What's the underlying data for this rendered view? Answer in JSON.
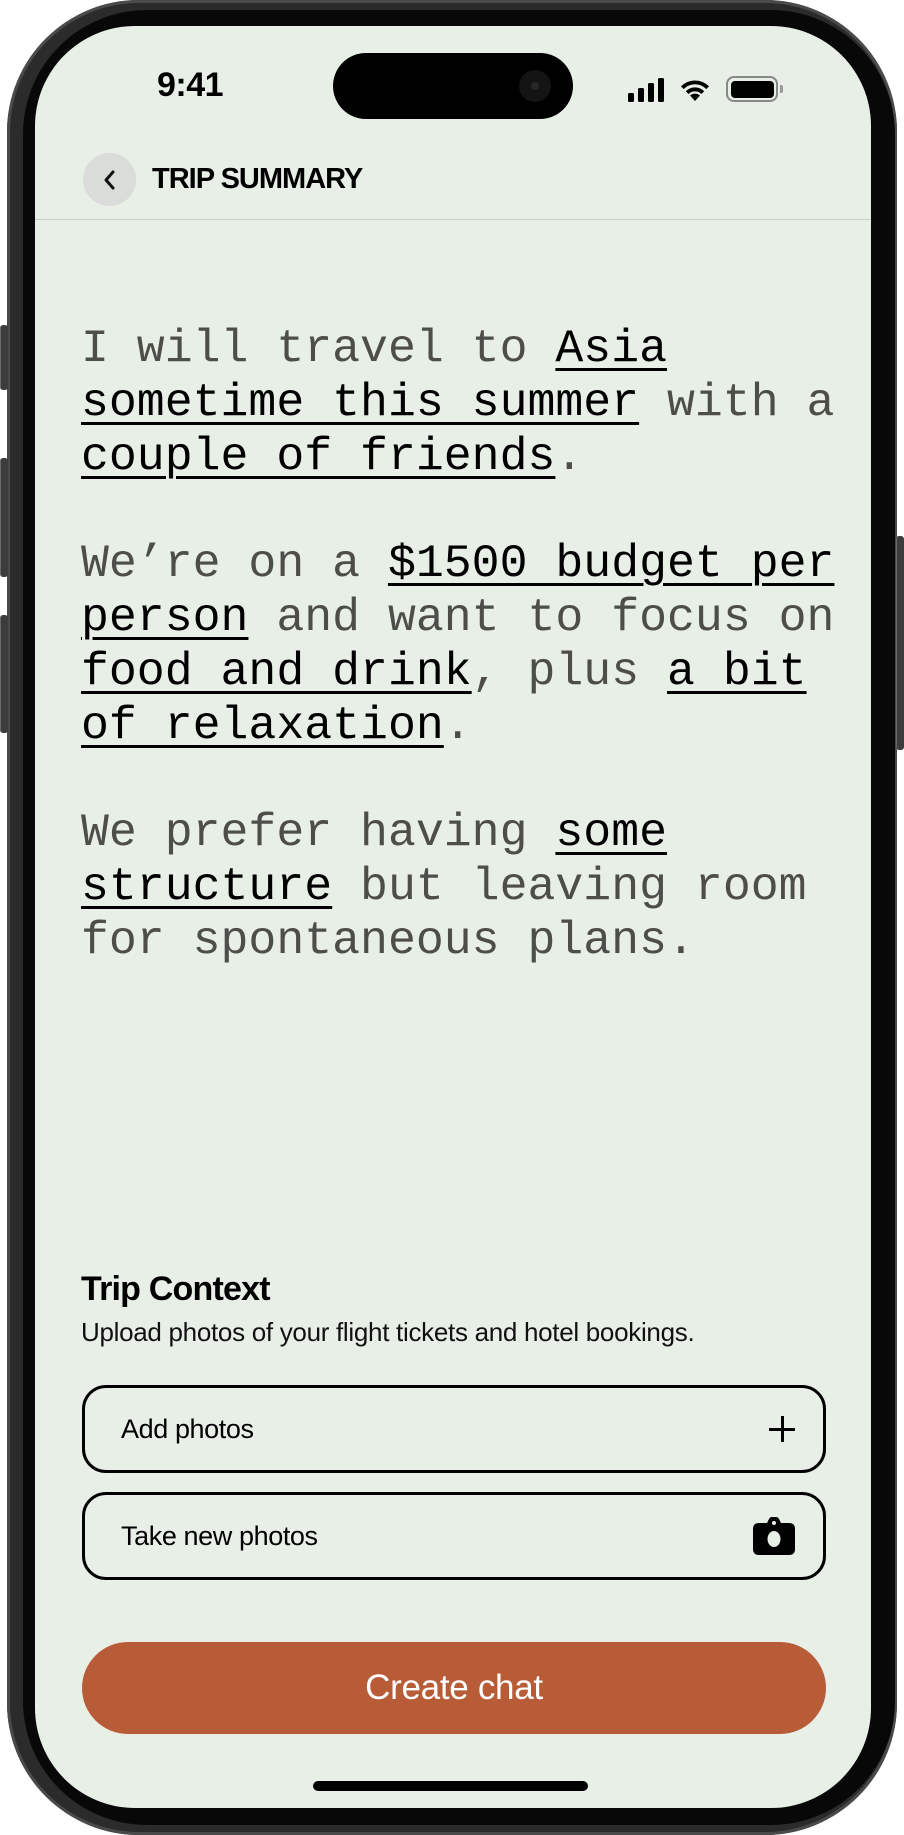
{
  "status_bar": {
    "time": "9:41",
    "icons": [
      "cellular-signal-icon",
      "wifi-icon",
      "battery-icon"
    ]
  },
  "header": {
    "back_icon": "chevron-left-icon",
    "title": "TRIP SUMMARY"
  },
  "summary": {
    "paragraphs": [
      [
        {
          "text": "I will travel to ",
          "highlight": false
        },
        {
          "text": "Asia sometime this summer",
          "highlight": true
        },
        {
          "text": " with a ",
          "highlight": false
        },
        {
          "text": "couple of friends",
          "highlight": true
        },
        {
          "text": ".",
          "highlight": false
        }
      ],
      [
        {
          "text": "We’re on a ",
          "highlight": false
        },
        {
          "text": "$1500 budget per person",
          "highlight": true
        },
        {
          "text": " and want to focus on ",
          "highlight": false
        },
        {
          "text": "food and drink",
          "highlight": true
        },
        {
          "text": ", plus ",
          "highlight": false
        },
        {
          "text": "a bit of relaxation",
          "highlight": true
        },
        {
          "text": ".",
          "highlight": false
        }
      ],
      [
        {
          "text": "We prefer having ",
          "highlight": false
        },
        {
          "text": "some structure",
          "highlight": true
        },
        {
          "text": " but leaving room for spontaneous plans.",
          "highlight": false
        }
      ]
    ]
  },
  "trip_context": {
    "title": "Trip Context",
    "subtitle": "Upload photos of your flight tickets and hotel bookings.",
    "options": [
      {
        "label": "Add photos",
        "icon": "plus-icon"
      },
      {
        "label": "Take new photos",
        "icon": "camera-icon"
      }
    ]
  },
  "primary_action": {
    "label": "Create chat"
  },
  "colors": {
    "background": "#E8EFE7",
    "accent": "#B85C38",
    "body_text": "#4D4D4A",
    "highlight_text": "#000000"
  }
}
